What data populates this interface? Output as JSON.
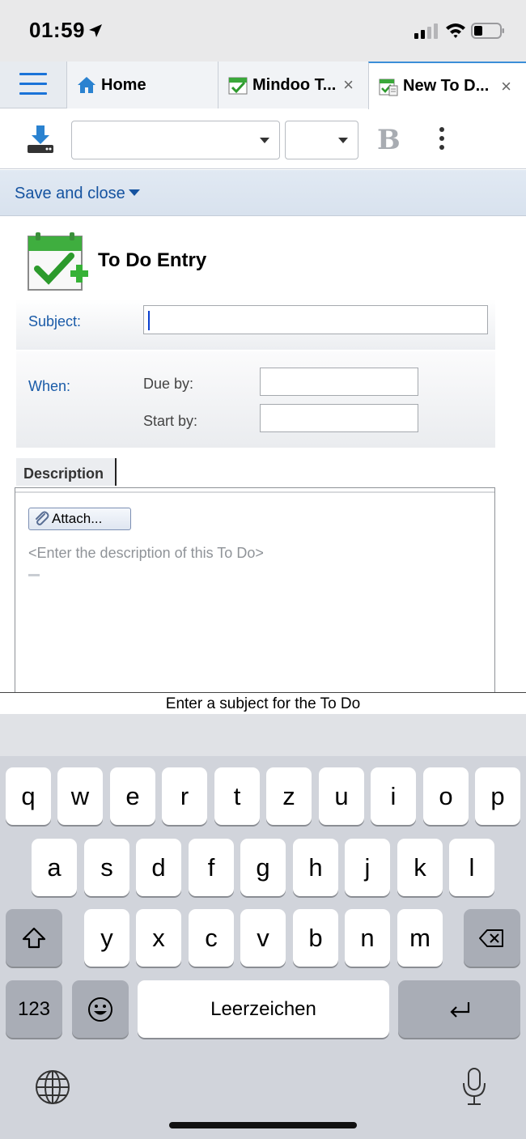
{
  "status_bar": {
    "time": "01:59"
  },
  "tabs": [
    {
      "label": "Home"
    },
    {
      "label": "Mindoo T..."
    },
    {
      "label": "New To D..."
    }
  ],
  "tab_close_glyph": "×",
  "toolbar": {
    "font_select_value": "",
    "size_select_value": "",
    "bold_label": "B"
  },
  "action_bar": {
    "save_close_label": "Save and close"
  },
  "form": {
    "title": "To Do Entry",
    "subject_label": "Subject:",
    "subject_value": "",
    "when_label": "When:",
    "due_label": "Due by:",
    "start_label": "Start by:",
    "due_value": "",
    "start_value": ""
  },
  "description": {
    "tab_label": "Description",
    "attach_label": "Attach...",
    "placeholder": "<Enter the description of this To Do>"
  },
  "hint": "Enter a subject for the To Do",
  "keyboard": {
    "row1": [
      "q",
      "w",
      "e",
      "r",
      "t",
      "z",
      "u",
      "i",
      "o",
      "p"
    ],
    "row2": [
      "a",
      "s",
      "d",
      "f",
      "g",
      "h",
      "j",
      "k",
      "l"
    ],
    "row3": [
      "y",
      "x",
      "c",
      "v",
      "b",
      "n",
      "m"
    ],
    "numbers_label": "123",
    "space_label": "Leerzeichen"
  },
  "colors": {
    "accent_blue": "#1a73d8",
    "label_blue": "#1a5ba8",
    "icon_green": "#2fa52f"
  }
}
